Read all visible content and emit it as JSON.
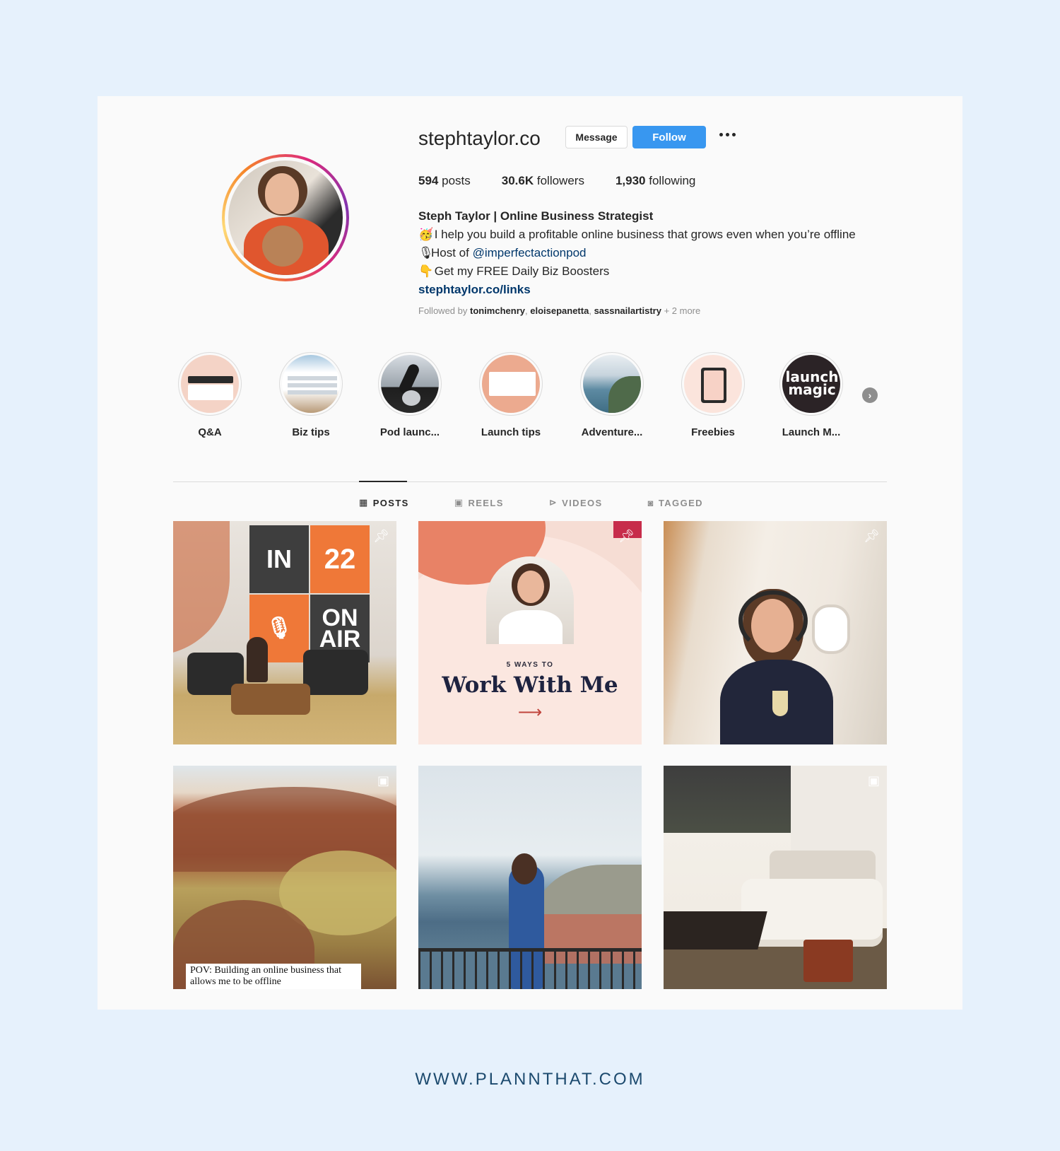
{
  "profile": {
    "username": "stephtaylor.co",
    "message_label": "Message",
    "follow_label": "Follow",
    "stats": {
      "posts_count": "594",
      "posts_label": "posts",
      "followers_count": "30.6K",
      "followers_label": "followers",
      "following_count": "1,930",
      "following_label": "following"
    },
    "bio": {
      "name": "Steph Taylor | Online Business Strategist",
      "line1_emoji": "🥳",
      "line1": "I help you build a profitable online business that grows even when you’re offline",
      "line2_emoji": "🎙",
      "line2_prefix": "Host of ",
      "line2_mention": "@imperfectactionpod",
      "line3_emoji": "👇",
      "line3": "Get my FREE Daily Biz Boosters",
      "link": "stephtaylor.co/links"
    },
    "followed_by": {
      "prefix": "Followed by ",
      "user1": "tonimchenry",
      "sep1": ", ",
      "user2": "eloisepanetta",
      "sep2": ", ",
      "user3": "sassnailartistry",
      "suffix": " + 2 more"
    }
  },
  "highlights": [
    {
      "label": "Q&A"
    },
    {
      "label": "Biz tips"
    },
    {
      "label": "Pod launc..."
    },
    {
      "label": "Launch tips"
    },
    {
      "label": "Adventure..."
    },
    {
      "label": "Freebies"
    },
    {
      "label": "Launch M..."
    }
  ],
  "highlight_texts": {
    "launch_magic": "launch magic"
  },
  "tabs": [
    {
      "label": "POSTS",
      "icon": "grid-icon",
      "active": true
    },
    {
      "label": "REELS",
      "icon": "reels-icon",
      "active": false
    },
    {
      "label": "VIDEOS",
      "icon": "play-icon",
      "active": false
    },
    {
      "label": "TAGGED",
      "icon": "tag-icon",
      "active": false
    }
  ],
  "posts": {
    "p1": {
      "sign_in": "IN",
      "sign_22": "22",
      "sign_on_air": "ON AIR",
      "badge": "pin-icon"
    },
    "p2": {
      "kicker": "5 WAYS TO",
      "headline": "Work With Me",
      "arrow": "⟶",
      "badge": "pin-icon"
    },
    "p3": {
      "badge": "pin-icon"
    },
    "p4": {
      "caption": "POV: Building an online business that allows me to be offline",
      "badge": "reels-icon"
    },
    "p5": {},
    "p6": {
      "badge": "reels-icon"
    }
  },
  "colors": {
    "page_bg": "#e6f1fc",
    "follow_blue": "#3897f0",
    "link_blue": "#00376b"
  },
  "footer": {
    "url": "WWW.PLANNTHAT.COM"
  }
}
